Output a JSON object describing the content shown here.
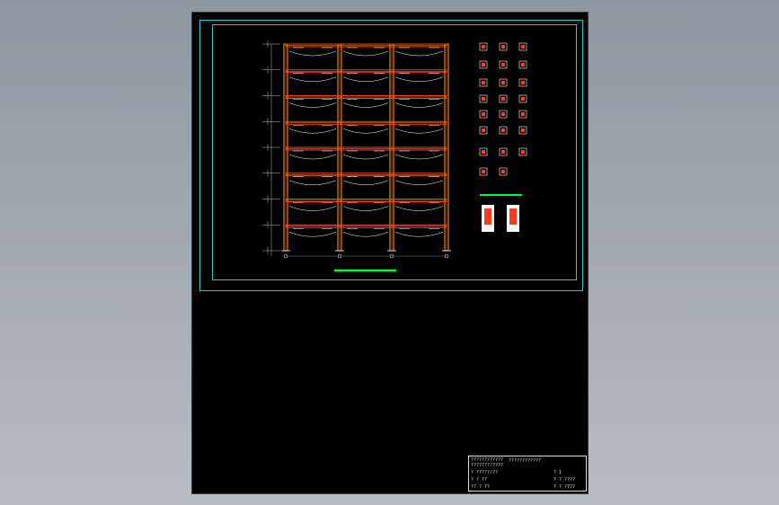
{
  "sheet": {
    "title_block": {
      "project": "????????????",
      "rows_left": [
        "????????????",
        "????????????",
        "?  ?????/??",
        "?  ?  ??",
        "?? ?  ??"
      ],
      "rows_right": [
        "? 1",
        "?  ?  ????",
        "?  ?  ?7??"
      ]
    }
  },
  "colors": {
    "frame": "#2fc7c7",
    "beam": "#ff3b1f",
    "column": "#f5a623",
    "rebar": "#ffffff",
    "accent_line": "#00ff2a",
    "background": "#000000",
    "viewport": "#a9b0b8"
  },
  "icons": {
    "sections": "section-detail-icon"
  }
}
